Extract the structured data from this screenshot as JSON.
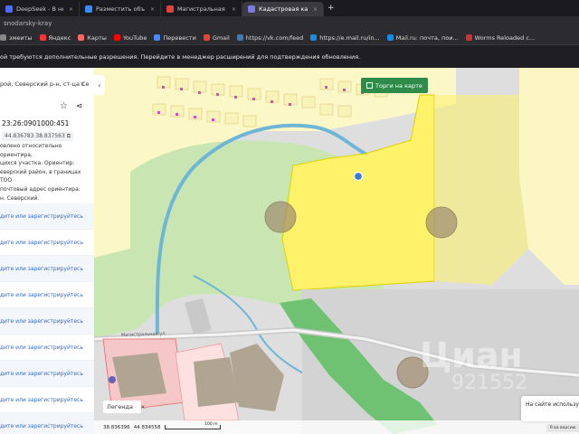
{
  "tabs": [
    {
      "title": "DeepSeek - В неизвестн",
      "color": "#4d6bfe",
      "active": false
    },
    {
      "title": "Разместить объявление с",
      "color": "#3a8bff",
      "active": false
    },
    {
      "title": "Магистральная улица —",
      "color": "#e04040",
      "active": false
    },
    {
      "title": "Кадастровая карта: Крас",
      "color": "#7a7ae0",
      "active": true
    }
  ],
  "new_tab": "+",
  "url": "snodarsky-kray",
  "bookmarks": [
    {
      "label": "змеиты",
      "color": "#888"
    },
    {
      "label": "Яндекс",
      "color": "#f33"
    },
    {
      "label": "Карты",
      "color": "#f66"
    },
    {
      "label": "YouTube",
      "color": "#f00"
    },
    {
      "label": "Перевести",
      "color": "#4a8af4"
    },
    {
      "label": "Gmail",
      "color": "#ea4335"
    },
    {
      "label": "https://vk.com/feed",
      "color": "#4a76a8"
    },
    {
      "label": "https://e.mail.ru/in...",
      "color": "#168de2"
    },
    {
      "label": "Mail.ru: почта, пои...",
      "color": "#168de2"
    },
    {
      "label": "Worms Reloaded с...",
      "color": "#c33"
    }
  ],
  "notice": "ой требуются дополнительные разрешения. Перейдите в менеджер расширений для подтверждения обновления.",
  "sidebar": {
    "address": "рой, Северский р-н, ст-ца Се",
    "close": "×",
    "cad_number": "23:26:0901000:451",
    "coords": "44.836783 38.837563",
    "description": [
      "овлено относительно ориентира,",
      "цихся участка. Ориентир:",
      "еверский район, в границах ТОО",
      "почтовый адрес ориентира:",
      "н. Северский."
    ],
    "links": [
      "дите или зарегистрируйтесь",
      "дите или зарегистрируйтесь",
      "дите или зарегистрируйтесь",
      "дите или зарегистрируйтесь",
      "дите или зарегистрируйтесь",
      "дите или зарегистрируйтесь",
      "дите или зарегистрируйтесь",
      "дите или зарегистрируйтесь",
      "дите или зарегистрируйтесь"
    ]
  },
  "map": {
    "torgi_label": "Торги на карте",
    "legend_label": "Легенда",
    "legend_close": "×",
    "coord_x": "38.836396",
    "coord_y": "44.834558",
    "scale_label": "100 m",
    "street_label": "Магистральная ул.",
    "cookie_text": "На сайте использу",
    "cookie_button": "Я ва версию",
    "watermark": "Циан",
    "watermark_num": "921552",
    "colors": {
      "parcel": "#fdf26a",
      "green": "#c9e6b2",
      "river": "#6fb6d6",
      "settlement": "#fbf7c7"
    }
  }
}
